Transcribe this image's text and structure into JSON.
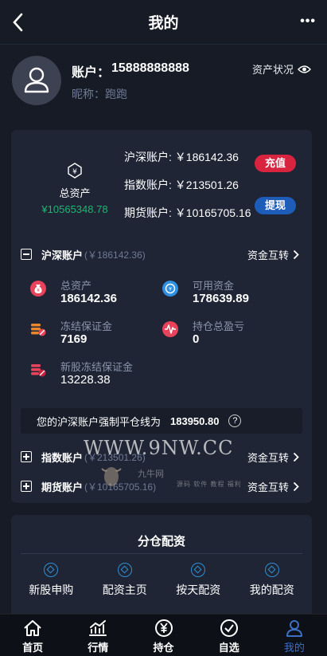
{
  "header": {
    "title": "我的",
    "back_icon": "chevron-left-icon",
    "more_icon": "more-dots-icon"
  },
  "profile": {
    "account_label": "账户：",
    "account_number": "15888888888",
    "nickname": "昵称：跑跑",
    "asset_status": "资产状况",
    "avatar_icon": "user-avatar-icon",
    "eye_icon": "eye-icon"
  },
  "overview": {
    "total_assets_label": "总资产",
    "total_assets_value": "¥10565348.78",
    "accounts": [
      {
        "label": "沪深账户:",
        "value": "￥186142.36"
      },
      {
        "label": "指数账户:",
        "value": "￥213501.26"
      },
      {
        "label": "期货账户:",
        "value": "￥10165705.16"
      }
    ],
    "recharge_label": "充值",
    "withdraw_label": "提现"
  },
  "hushen": {
    "name": "沪深账户",
    "amount": "(￥186142.36)",
    "transfer": "资金互转",
    "stats": [
      {
        "label": "总资产",
        "value": "186142.36",
        "icon": "money-bag-icon"
      },
      {
        "label": "可用资金",
        "value": "178639.89",
        "icon": "coin-available-icon"
      },
      {
        "label": "冻结保证金",
        "value": "7169",
        "icon": "frozen-coins-icon"
      },
      {
        "label": "持仓总盈亏",
        "value": "0",
        "icon": "pulse-icon"
      },
      {
        "label": "新股冻结保证金",
        "value": "13228.38",
        "icon": "frozen-stack-icon"
      }
    ],
    "liquidation_text": "您的沪深账户强制平仓线为",
    "liquidation_value": "183950.80",
    "help_symbol": "?"
  },
  "index_account": {
    "name": "指数账户",
    "amount": "(￥213501.26)",
    "transfer": "资金互转"
  },
  "futures_account": {
    "name": "期货账户",
    "amount": "(￥10165705.16)",
    "transfer": "资金互转"
  },
  "watermark": {
    "main": "WWW.9NW.CC",
    "brand": "九牛网",
    "tags": "源码 软件 教程 福利"
  },
  "allocation": {
    "title": "分仓配资",
    "items": [
      {
        "label": "新股申购"
      },
      {
        "label": "配资主页"
      },
      {
        "label": "按天配资"
      },
      {
        "label": "我的配资"
      }
    ]
  },
  "tabbar": [
    {
      "label": "首页",
      "icon": "home-icon"
    },
    {
      "label": "行情",
      "icon": "chart-icon"
    },
    {
      "label": "持仓",
      "icon": "yen-icon"
    },
    {
      "label": "自选",
      "icon": "check-circle-icon"
    },
    {
      "label": "我的",
      "icon": "person-icon"
    }
  ],
  "colors": {
    "background": "#161b26",
    "card": "#1f2535",
    "accent_red": "#d8243f",
    "accent_blue": "#1d5cb8",
    "positive": "#1fb570",
    "active_tab": "#3d6fc2"
  }
}
